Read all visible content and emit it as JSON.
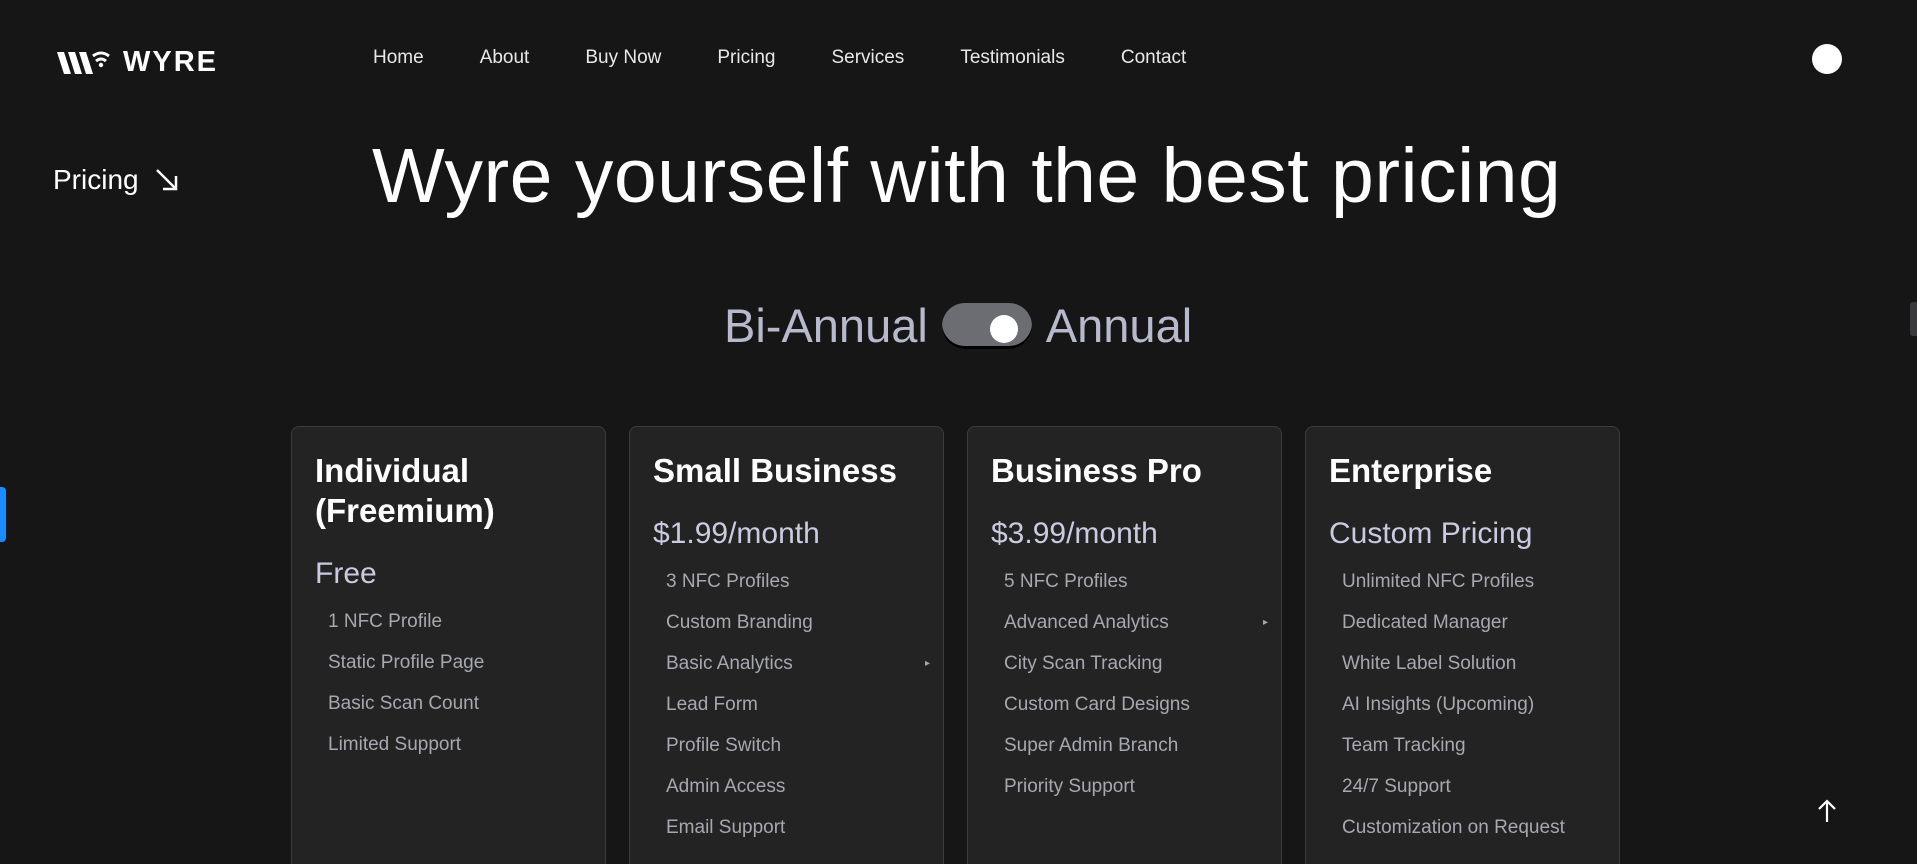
{
  "brand": {
    "name": "WYRE",
    "logo_icon": "wyre-logo-icon"
  },
  "nav": {
    "items": [
      {
        "label": "Home"
      },
      {
        "label": "About"
      },
      {
        "label": "Buy Now"
      },
      {
        "label": "Pricing"
      },
      {
        "label": "Services"
      },
      {
        "label": "Testimonials"
      },
      {
        "label": "Contact"
      }
    ]
  },
  "theme_toggle": {
    "icon": "theme-dot-icon"
  },
  "section": {
    "label": "Pricing",
    "icon": "arrow-down-right-icon"
  },
  "headline": "Wyre yourself with the best pricing",
  "billing": {
    "left_label": "Bi-Annual",
    "right_label": "Annual",
    "selected": "Annual"
  },
  "plans": [
    {
      "title": "Individual (Freemium)",
      "price": "Free",
      "features": [
        "1 NFC Profile",
        "Static Profile Page",
        "Basic Scan Count",
        "Limited Support"
      ]
    },
    {
      "title": "Small Business",
      "price": "$1.99/month",
      "features": [
        "3 NFC Profiles",
        "Custom Branding",
        "Basic Analytics",
        "Lead Form",
        "Profile Switch",
        "Admin Access",
        "Email Support"
      ]
    },
    {
      "title": "Business Pro",
      "price": "$3.99/month",
      "features": [
        "5 NFC Profiles",
        "Advanced Analytics",
        "City Scan Tracking",
        "Custom Card Designs",
        "Super Admin Branch",
        "Priority Support"
      ]
    },
    {
      "title": "Enterprise",
      "price": "Custom Pricing",
      "features": [
        "Unlimited NFC Profiles",
        "Dedicated Manager",
        "White Label Solution",
        "AI Insights (Upcoming)",
        "Team Tracking",
        "24/7 Support",
        "Customization on Request"
      ]
    }
  ],
  "colors": {
    "background": "#161617",
    "card": "#232324",
    "accent": "#1a8cff",
    "muted_text": "#a7a8b0"
  },
  "scroll_top": {
    "icon": "arrow-up-icon"
  }
}
